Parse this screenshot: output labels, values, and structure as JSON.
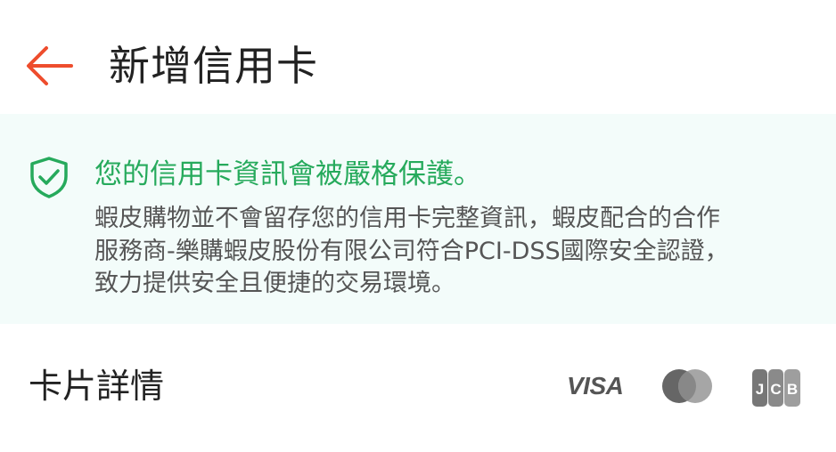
{
  "header": {
    "title": "新增信用卡",
    "back_icon": "arrow-left-icon",
    "accent_color": "#ee4d2d"
  },
  "notice": {
    "icon": "shield-check-icon",
    "title": "您的信用卡資訊會被嚴格保護。",
    "body_lines": [
      "蝦皮購物並不會留存您的信用卡完整資訊，蝦皮配合的合作",
      "服務商-樂購蝦皮股份有限公司符合PCI-DSS國際安全認證，",
      "致力提供安全且便捷的交易環境。"
    ],
    "title_color": "#26aa5c",
    "background_color": "#f3fcfa"
  },
  "card_details": {
    "label": "卡片詳情",
    "brands": {
      "visa": "VISA",
      "mastercard": "mastercard-logo",
      "jcb": "JCB"
    }
  }
}
